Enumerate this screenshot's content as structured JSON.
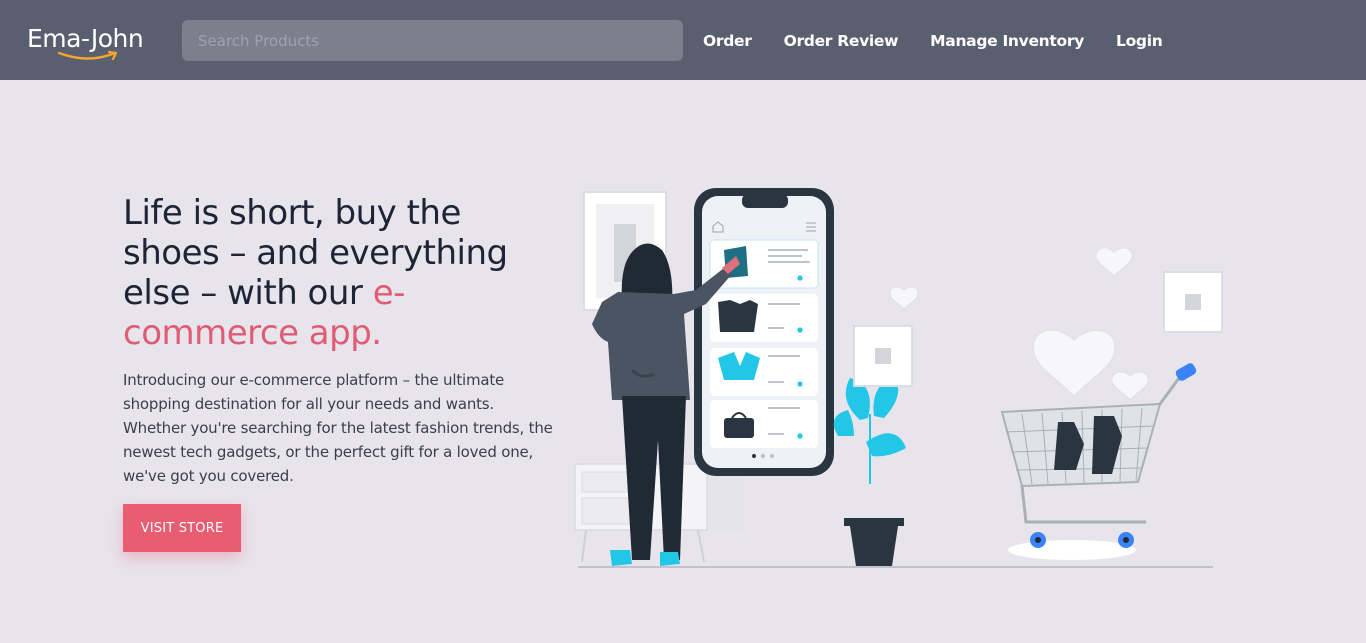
{
  "brand": {
    "name": "Ema-John",
    "smile_color": "#f4a52b"
  },
  "search": {
    "placeholder": "Search Products",
    "value": ""
  },
  "nav": [
    {
      "label": "Order"
    },
    {
      "label": "Order Review"
    },
    {
      "label": "Manage Inventory"
    },
    {
      "label": "Login"
    }
  ],
  "hero": {
    "title_main": "Life is short, buy the shoes – and everything else – with our ",
    "title_accent": "e-commerce app.",
    "body": "Introducing our e-commerce platform – the ultimate shopping destination for all your needs and wants. Whether you're searching for the latest fashion trends, the newest tech gadgets, or the perfect gift for a loved one, we've got you covered.",
    "cta_label": "VISIT STORE"
  },
  "colors": {
    "navbar": "#5a5f70",
    "background": "#e8e4ec",
    "accent": "#e05c73",
    "button": "#e85d72",
    "illustration_cyan": "#22c6e6",
    "illustration_dark": "#2a3542"
  }
}
